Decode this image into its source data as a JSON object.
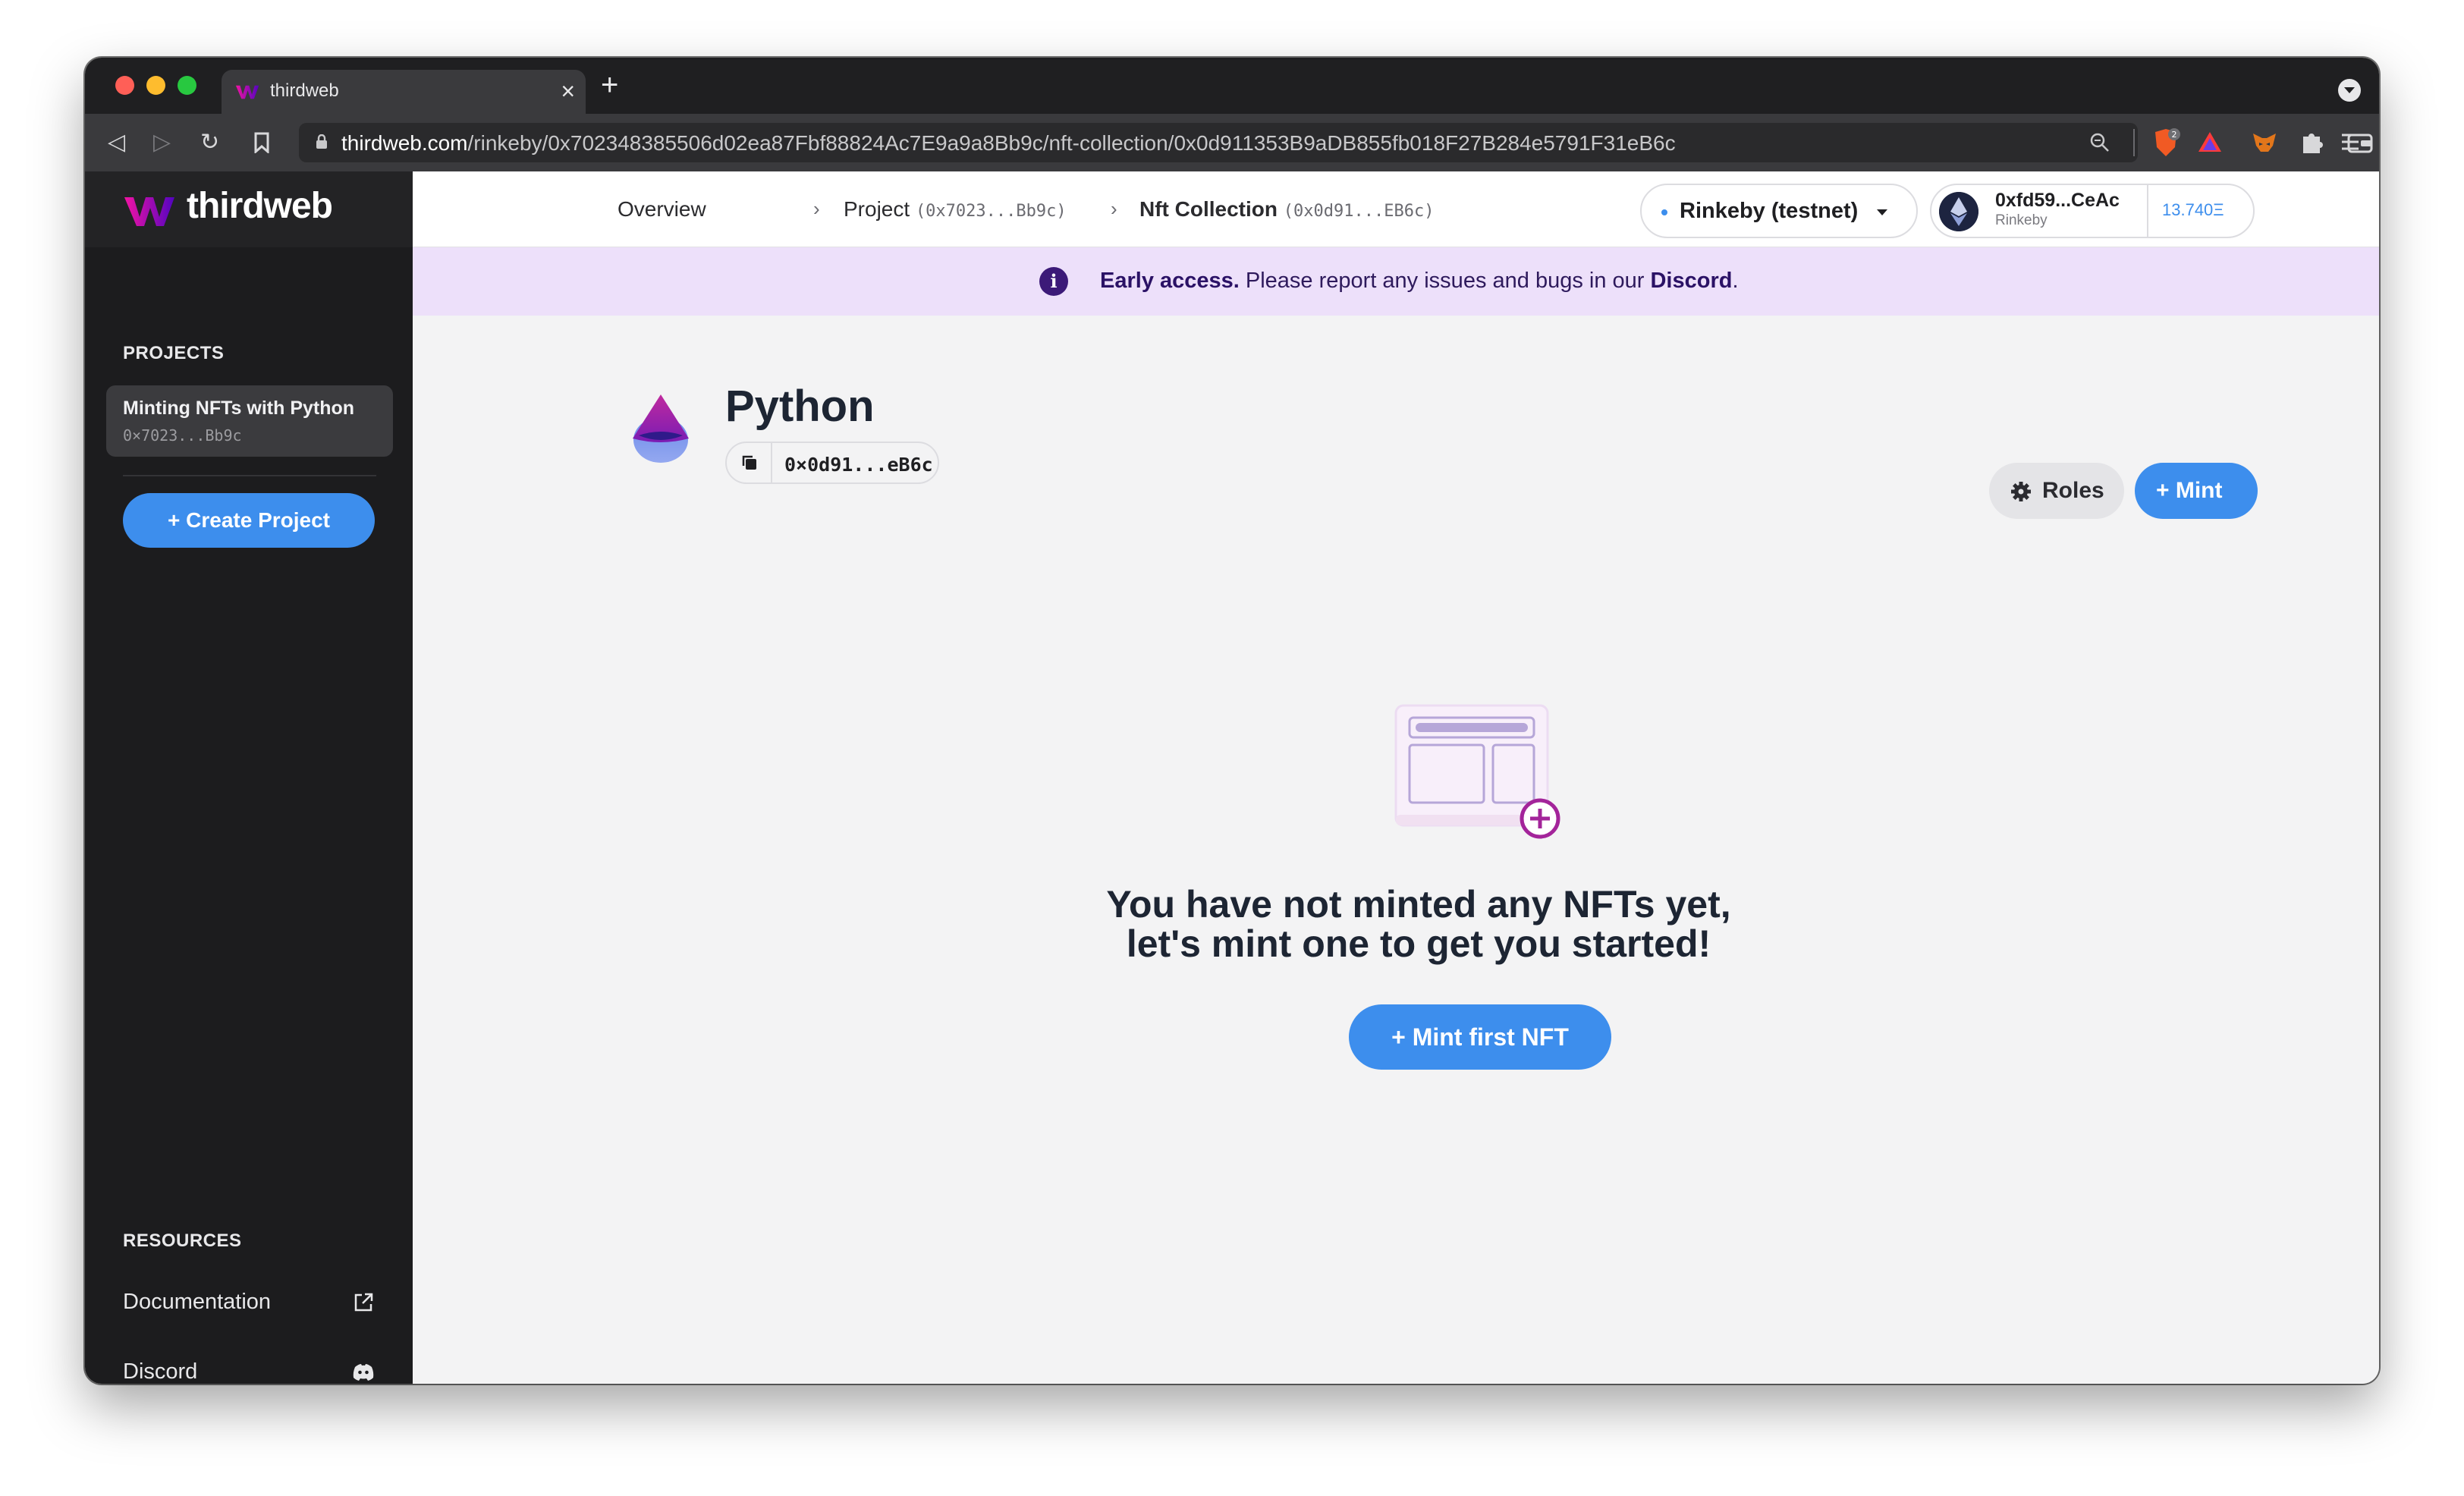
{
  "browser": {
    "tab": {
      "title": "thirdweb",
      "close_glyph": "×",
      "favicon": "thirdweb-logo-icon"
    },
    "new_tab_glyph": "+",
    "nav": {
      "back": "◁",
      "forward": "▷",
      "reload": "↻",
      "bookmark": "bookmark-icon"
    },
    "url": {
      "host": "thirdweb.com",
      "path": "/rinkeby/0x702348385506d02ea87Fbf88824Ac7E9a9a8Bb9c/nft-collection/0x0d911353B9aDB855fb018F27B284e5791F31eB6c"
    },
    "extensions": [
      "brave-shields-icon",
      "brave-rewards-icon",
      "metamask-fox-icon",
      "puzzle-extensions-icon",
      "wallet-icon",
      "menu-icon"
    ],
    "shields_count": "2"
  },
  "sidebar": {
    "brand": "thirdweb",
    "projects_heading": "PROJECTS",
    "project": {
      "name": "Minting NFTs with Python",
      "address": "0×7023...Bb9c"
    },
    "create_button": "+  Create Project",
    "resources_heading": "RESOURCES",
    "links": [
      {
        "label": "Documentation",
        "icon": "external-link-icon"
      },
      {
        "label": "Discord",
        "icon": "discord-icon"
      }
    ]
  },
  "topnav": {
    "breadcrumb": [
      {
        "label": "Overview"
      },
      {
        "label": "Project",
        "detail": "(0x7023...Bb9c)"
      },
      {
        "label": "Nft Collection",
        "detail": "(0x0d91...EB6c)"
      }
    ],
    "separator": "›",
    "network": "Rinkeby (testnet)",
    "wallet": {
      "address": "0xfd59...CeAc",
      "network": "Rinkeby",
      "balance": "13.740Ξ"
    }
  },
  "banner": {
    "icon": "i",
    "strong": "Early access.",
    "text": " Please report any issues and bugs in our ",
    "link": "Discord",
    "end": "."
  },
  "contract": {
    "name": "Python",
    "address": "0×0d91...eB6c",
    "roles_button": "Roles",
    "mint_button": "+  Mint"
  },
  "empty_state": {
    "line1": "You have not minted any NFTs yet,",
    "line2": "let's mint one to get you started!",
    "button": "+  Mint first NFT"
  },
  "colors": {
    "accent": "#3d8eed",
    "sidebar_bg": "#1c1c1e",
    "banner_bg": "#ede0fa",
    "brand_gradient": [
      "#f213a4",
      "#5204bf"
    ]
  }
}
